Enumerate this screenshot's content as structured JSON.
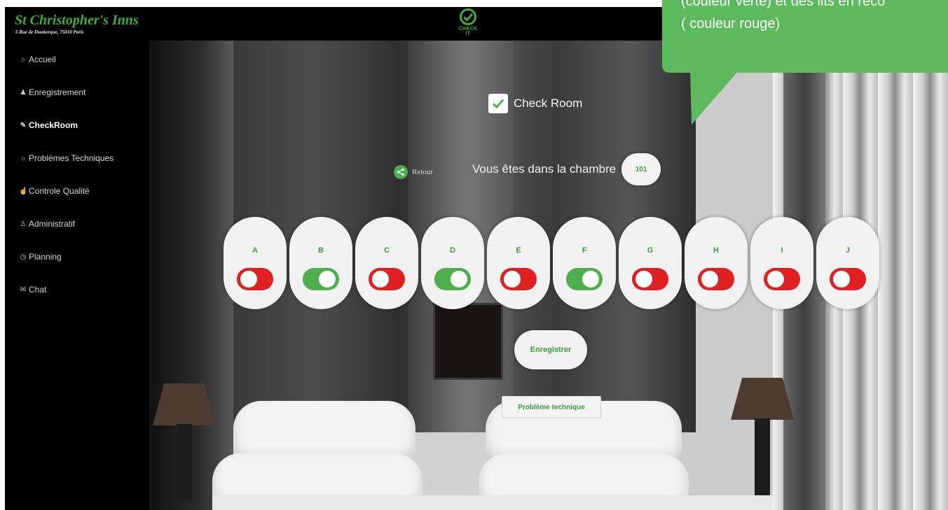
{
  "brand": {
    "name": "St Christopher's Inns",
    "address": "5 Rue de Dunkerque, 75010 Paris"
  },
  "logo": {
    "text": "CHECK IT",
    "icon": "check-circle-icon"
  },
  "sidebar": {
    "items": [
      {
        "label": "Accueil",
        "icon": "home-icon",
        "active": false
      },
      {
        "label": "Enregistrement",
        "icon": "users-icon",
        "active": false
      },
      {
        "label": "CheckRoom",
        "icon": "edit-icon",
        "active": true
      },
      {
        "label": "Problèmes Techniques",
        "icon": "lightbulb-icon",
        "active": false
      },
      {
        "label": "Controle Qualité",
        "icon": "thumbs-up-icon",
        "active": false
      },
      {
        "label": "Administratif",
        "icon": "user-icon",
        "active": false
      },
      {
        "label": "Planning",
        "icon": "clock-icon",
        "active": false
      },
      {
        "label": "Chat",
        "icon": "chat-icon",
        "active": false
      }
    ]
  },
  "callout": {
    "line1": "(couleur verte) et des lits en reco",
    "line2": "( couleur rouge)",
    "color": "#5cba5c"
  },
  "main": {
    "check_room_label": "Check Room",
    "check_room_checked": true,
    "retour_label": "Retour",
    "room_text": "Vous êtes dans la chambre",
    "room_number": "101",
    "beds": [
      {
        "letter": "A",
        "state": "off"
      },
      {
        "letter": "B",
        "state": "on"
      },
      {
        "letter": "C",
        "state": "off"
      },
      {
        "letter": "D",
        "state": "on"
      },
      {
        "letter": "E",
        "state": "off"
      },
      {
        "letter": "F",
        "state": "on"
      },
      {
        "letter": "G",
        "state": "off"
      },
      {
        "letter": "H",
        "state": "off"
      },
      {
        "letter": "I",
        "state": "off"
      },
      {
        "letter": "J",
        "state": "off"
      }
    ],
    "save_label": "Enregistrer",
    "tech_problem_label": "Problème technique"
  },
  "colors": {
    "accent_green": "#4cae4c",
    "toggle_red": "#e02020",
    "brand_green": "#3fae3b"
  }
}
